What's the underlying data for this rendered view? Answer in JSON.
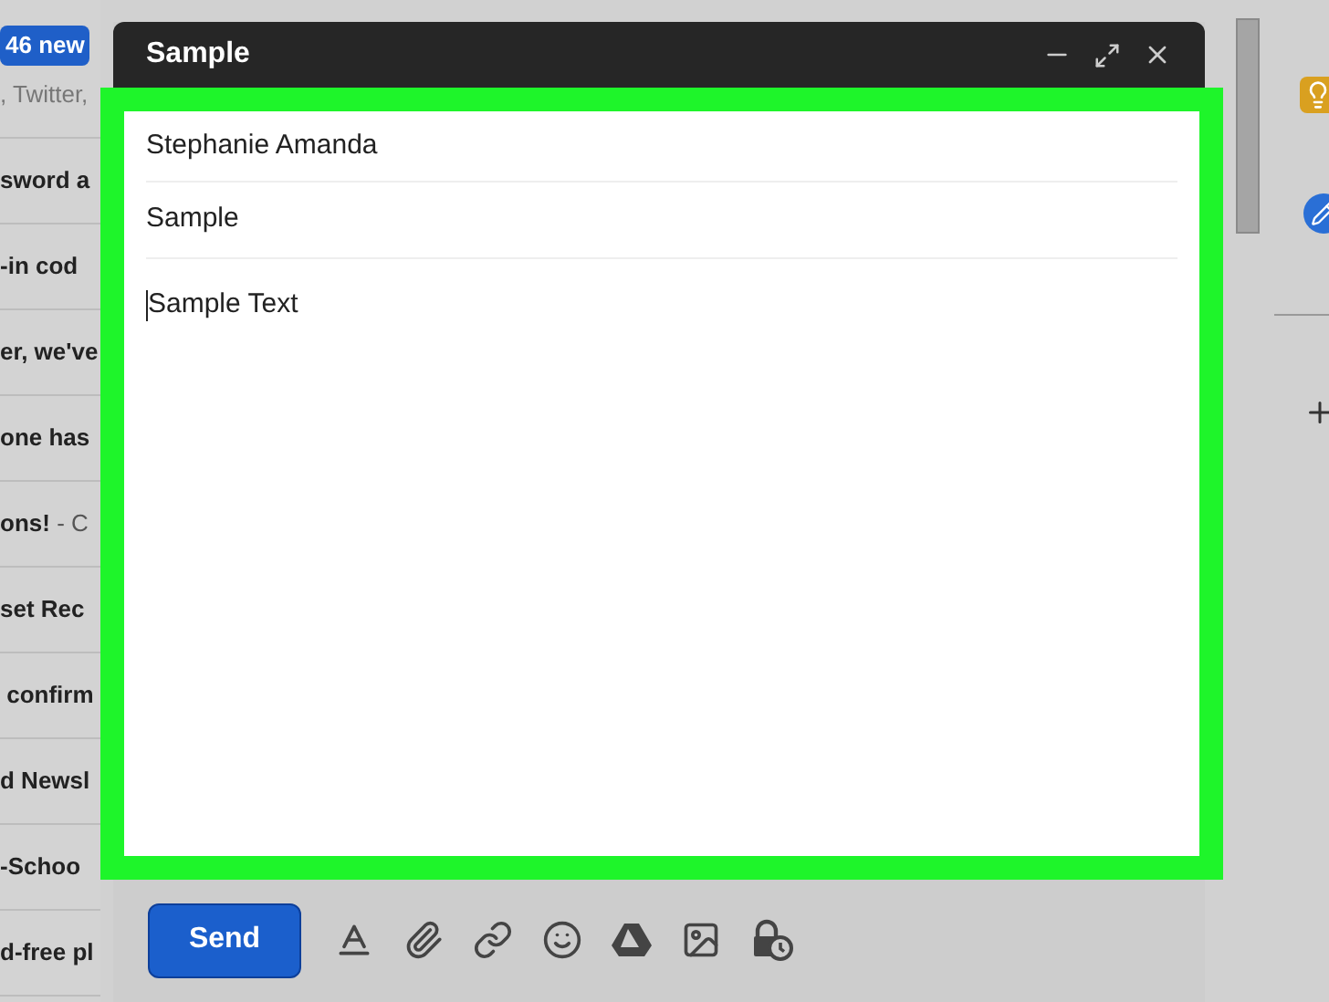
{
  "inbox": {
    "new_badge": "46 new",
    "categories": ", Twitter,",
    "rows": [
      {
        "subject": "sword a"
      },
      {
        "subject": "-in cod"
      },
      {
        "subject": "er, we've"
      },
      {
        "subject": "one has"
      },
      {
        "subject": "ons!",
        "snippet": " - C"
      },
      {
        "subject": "set Rec"
      },
      {
        "subject": " confirm"
      },
      {
        "subject": "d Newsl"
      },
      {
        "subject": "-Schoo"
      },
      {
        "subject": "d-free pl"
      }
    ]
  },
  "compose": {
    "title": "Sample",
    "to": "Stephanie Amanda",
    "subject": "Sample",
    "body": "Sample Text",
    "send": "Send"
  }
}
